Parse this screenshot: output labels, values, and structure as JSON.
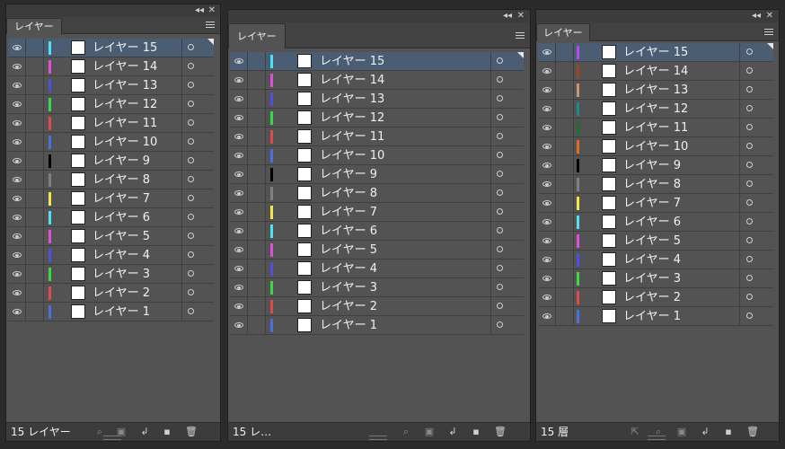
{
  "panels": [
    {
      "tab": "レイヤー",
      "footer": "15 レイヤー",
      "layers": [
        {
          "name": "レイヤー 15",
          "color": "#4de1f5"
        },
        {
          "name": "レイヤー 14",
          "color": "#e24ed8"
        },
        {
          "name": "レイヤー 13",
          "color": "#5050e0"
        },
        {
          "name": "レイヤー 12",
          "color": "#39d94a"
        },
        {
          "name": "レイヤー 11",
          "color": "#e04a4a"
        },
        {
          "name": "レイヤー 10",
          "color": "#4a70e0"
        },
        {
          "name": "レイヤー 9",
          "color": "#000000"
        },
        {
          "name": "レイヤー 8",
          "color": "#808080"
        },
        {
          "name": "レイヤー 7",
          "color": "#f3e84a"
        },
        {
          "name": "レイヤー 6",
          "color": "#4de1f5"
        },
        {
          "name": "レイヤー 5",
          "color": "#e24ed8"
        },
        {
          "name": "レイヤー 4",
          "color": "#5050e0"
        },
        {
          "name": "レイヤー 3",
          "color": "#39d94a"
        },
        {
          "name": "レイヤー 2",
          "color": "#e04a4a"
        },
        {
          "name": "レイヤー 1",
          "color": "#4a70e0"
        }
      ]
    },
    {
      "tab": "レイヤー",
      "footer": "15 レ…",
      "layers": [
        {
          "name": "レイヤー 15",
          "color": "#4de1f5"
        },
        {
          "name": "レイヤー 14",
          "color": "#e24ed8"
        },
        {
          "name": "レイヤー 13",
          "color": "#5050e0"
        },
        {
          "name": "レイヤー 12",
          "color": "#39d94a"
        },
        {
          "name": "レイヤー 11",
          "color": "#e04a4a"
        },
        {
          "name": "レイヤー 10",
          "color": "#4a70e0"
        },
        {
          "name": "レイヤー 9",
          "color": "#000000"
        },
        {
          "name": "レイヤー 8",
          "color": "#808080"
        },
        {
          "name": "レイヤー 7",
          "color": "#f3e84a"
        },
        {
          "name": "レイヤー 6",
          "color": "#4de1f5"
        },
        {
          "name": "レイヤー 5",
          "color": "#e24ed8"
        },
        {
          "name": "レイヤー 4",
          "color": "#5050e0"
        },
        {
          "name": "レイヤー 3",
          "color": "#39d94a"
        },
        {
          "name": "レイヤー 2",
          "color": "#e04a4a"
        },
        {
          "name": "レイヤー 1",
          "color": "#4a70e0"
        }
      ]
    },
    {
      "tab": "レイヤー",
      "footer": "15 層",
      "layers": [
        {
          "name": "レイヤー 15",
          "color": "#b24de8"
        },
        {
          "name": "レイヤー 14",
          "color": "#a0461e"
        },
        {
          "name": "レイヤー 13",
          "color": "#c8966e"
        },
        {
          "name": "レイヤー 12",
          "color": "#1e8c8c"
        },
        {
          "name": "レイヤー 11",
          "color": "#1e6e2e"
        },
        {
          "name": "レイヤー 10",
          "color": "#e06a1e"
        },
        {
          "name": "レイヤー 9",
          "color": "#000000"
        },
        {
          "name": "レイヤー 8",
          "color": "#808080"
        },
        {
          "name": "レイヤー 7",
          "color": "#f3e84a"
        },
        {
          "name": "レイヤー 6",
          "color": "#4de1f5"
        },
        {
          "name": "レイヤー 5",
          "color": "#e24ed8"
        },
        {
          "name": "レイヤー 4",
          "color": "#5050e0"
        },
        {
          "name": "レイヤー 3",
          "color": "#39d94a"
        },
        {
          "name": "レイヤー 2",
          "color": "#e04a4a"
        },
        {
          "name": "レイヤー 1",
          "color": "#4a70e0"
        }
      ]
    }
  ],
  "icons": {
    "collapse": "double-chevron-icon",
    "close": "close-icon",
    "menu": "panel-menu-icon",
    "visibility": "eye-icon",
    "target": "target-circle-icon",
    "footer": [
      "export-icon",
      "locate-object-icon",
      "make-clip-mask-icon",
      "new-sublayer-icon",
      "new-layer-icon",
      "delete-icon"
    ]
  }
}
